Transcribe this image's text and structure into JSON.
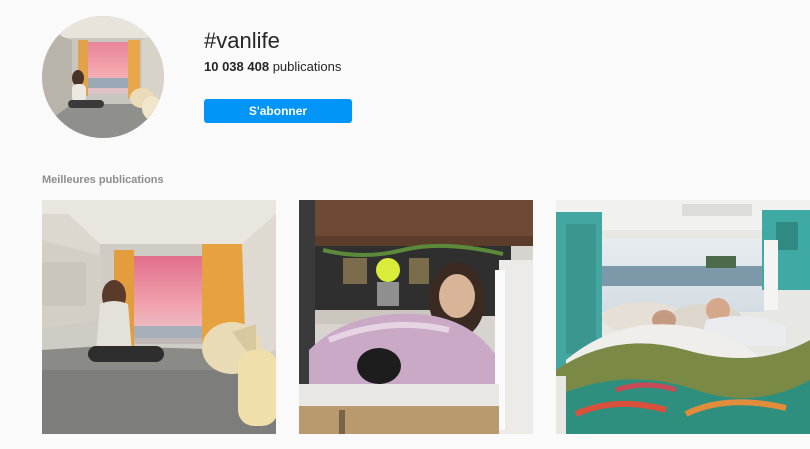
{
  "hashtag": {
    "title": "#vanlife",
    "post_count": "10 038 408",
    "post_count_label": "publications",
    "follow_label": "S'abonner"
  },
  "top_posts": {
    "section_title": "Meilleures publications",
    "items": [
      {
        "alt": "",
        "scene": "van-interior-sunset-woman-seated"
      },
      {
        "alt": "",
        "scene": "van-interior-woman-with-dog-in-blanket"
      },
      {
        "alt": "",
        "scene": "van-bed-couple-lake-view"
      }
    ]
  },
  "colors": {
    "accent": "#0095f6",
    "background": "#fafafa",
    "muted_text": "#8e8e8e"
  }
}
